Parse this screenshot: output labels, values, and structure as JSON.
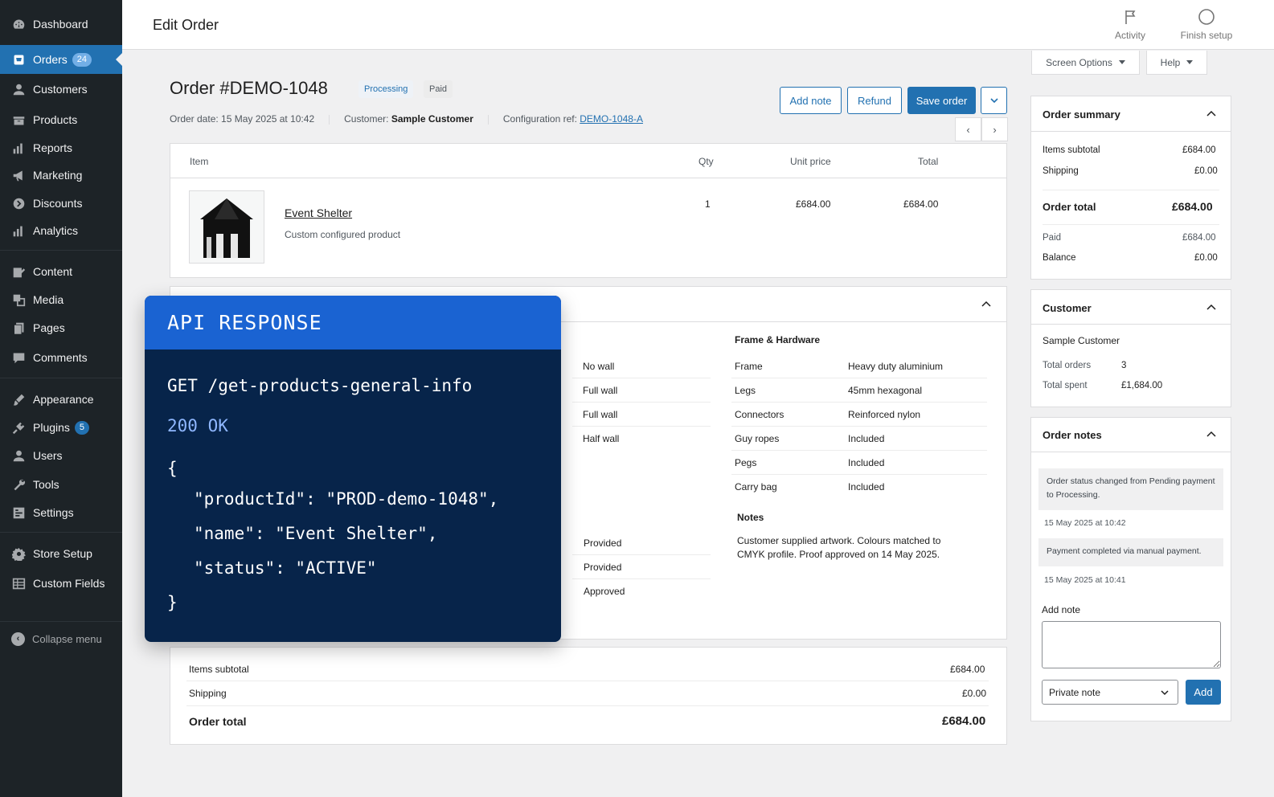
{
  "sidebar": {
    "items": [
      {
        "label": "Dashboard",
        "icon": "dashboard-icon"
      },
      {
        "label": "Orders",
        "icon": "cart-icon",
        "badge": "24"
      },
      {
        "label": "Customers",
        "icon": "person-icon"
      },
      {
        "label": "Products",
        "icon": "box-icon"
      },
      {
        "label": "Reports",
        "icon": "bar-chart-icon"
      },
      {
        "label": "Marketing",
        "icon": "megaphone-icon"
      },
      {
        "label": "Discounts",
        "icon": "tag-icon"
      },
      {
        "label": "Analytics",
        "icon": "analytics-icon"
      },
      {
        "label": "Content",
        "icon": "edit-icon"
      },
      {
        "label": "Media",
        "icon": "media-icon"
      },
      {
        "label": "Pages",
        "icon": "pages-icon"
      },
      {
        "label": "Comments",
        "icon": "comment-icon"
      },
      {
        "label": "Appearance",
        "icon": "brush-icon"
      },
      {
        "label": "Plugins",
        "icon": "plug-icon",
        "badge": "5"
      },
      {
        "label": "Users",
        "icon": "user-icon"
      },
      {
        "label": "Tools",
        "icon": "wrench-icon"
      },
      {
        "label": "Settings",
        "icon": "settings-icon"
      },
      {
        "label": "Store Setup",
        "icon": "gear-icon"
      },
      {
        "label": "Custom Fields",
        "icon": "grid-icon"
      }
    ],
    "collapse_label": "Collapse menu"
  },
  "topbar": {
    "title": "Edit Order",
    "activity_label": "Activity",
    "finish_setup_label": "Finish setup",
    "screen_options_label": "Screen Options",
    "help_label": "Help"
  },
  "order": {
    "title": "Order #DEMO-1048",
    "status_processing": "Processing",
    "status_paid": "Paid",
    "date_text": "Order date: 15 May 2025 at 10:42",
    "customer_label": "Customer:",
    "customer_name": "Sample Customer",
    "config_label": "Configuration ref:",
    "config_ref": "DEMO-1048-A",
    "add_note_label": "Add note",
    "refund_label": "Refund",
    "save_label": "Save order"
  },
  "items_table": {
    "headers": {
      "item": "Item",
      "qty": "Qty",
      "unit_price": "Unit price",
      "total": "Total"
    },
    "product_name": "Event Shelter",
    "product_desc": "Custom configured product",
    "qty": "1",
    "unit_price": "£684.00",
    "total": "£684.00"
  },
  "config": {
    "walls": [
      "No wall",
      "Full wall",
      "Full wall",
      "Half wall"
    ],
    "frame_heading": "Frame & Hardware",
    "frame_rows": [
      {
        "label": "Frame",
        "value": "Heavy duty aluminium"
      },
      {
        "label": "Legs",
        "value": "45mm hexagonal"
      },
      {
        "label": "Connectors",
        "value": "Reinforced nylon"
      },
      {
        "label": "Guy ropes",
        "value": "Included"
      },
      {
        "label": "Pegs",
        "value": "Included"
      },
      {
        "label": "Carry bag",
        "value": "Included"
      }
    ],
    "artwork_values": [
      "Provided",
      "Provided",
      "Approved"
    ],
    "notes_heading": "Notes",
    "notes_line1": "Customer supplied artwork. Colours matched to",
    "notes_line2": "CMYK profile. Proof approved on 14 May 2025."
  },
  "totals": {
    "items_subtotal_label": "Items subtotal",
    "items_subtotal": "£684.00",
    "shipping_label": "Shipping",
    "shipping": "£0.00",
    "order_total_label": "Order total",
    "order_total": "£684.00"
  },
  "api": {
    "heading": "API RESPONSE",
    "request": "GET /get-products-general-info",
    "status": "200 OK",
    "open_brace": "{",
    "line1": "\"productId\": \"PROD-demo-1048\",",
    "line2": "\"name\": \"Event Shelter\",",
    "line3": "\"status\": \"ACTIVE\"",
    "close_brace": "}"
  },
  "summary": {
    "title": "Order summary",
    "items_subtotal_label": "Items subtotal",
    "items_subtotal": "£684.00",
    "shipping_label": "Shipping",
    "shipping": "£0.00",
    "order_total_label": "Order total",
    "order_total": "£684.00",
    "paid_label": "Paid",
    "paid": "£684.00",
    "balance_label": "Balance",
    "balance": "£0.00"
  },
  "customer": {
    "title": "Customer",
    "name": "Sample Customer",
    "total_orders_label": "Total orders",
    "total_orders": "3",
    "total_spent_label": "Total spent",
    "total_spent": "£1,684.00"
  },
  "notes": {
    "title": "Order notes",
    "note1": "Order status changed from Pending payment to Processing.",
    "note1_time": "15 May 2025 at 10:42",
    "note2": "Payment completed via manual payment.",
    "note2_time": "15 May 2025 at 10:41",
    "add_note_label": "Add note",
    "note_type": "Private note",
    "add_button": "Add"
  }
}
